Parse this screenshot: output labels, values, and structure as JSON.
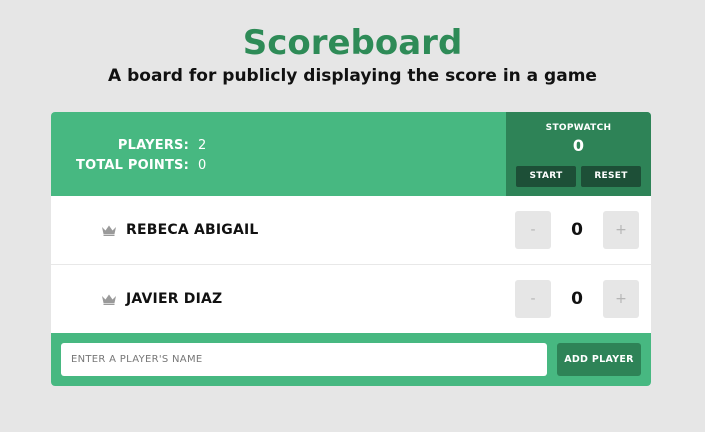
{
  "page": {
    "title": "Scoreboard",
    "subtitle": "A board for publicly displaying the score in a game"
  },
  "stats": {
    "players_label": "PLAYERS:",
    "players_value": "2",
    "points_label": "TOTAL POINTS:",
    "points_value": "0"
  },
  "stopwatch": {
    "label": "STOPWATCH",
    "time": "0",
    "start_label": "START",
    "reset_label": "RESET"
  },
  "players": [
    {
      "name": "REBECA ABIGAIL",
      "score": "0",
      "decrement_label": "-",
      "increment_label": "+",
      "icon": "crown-icon"
    },
    {
      "name": "JAVIER DIAZ",
      "score": "0",
      "decrement_label": "-",
      "increment_label": "+",
      "icon": "crown-icon"
    }
  ],
  "add_player": {
    "placeholder": "ENTER A PLAYER'S NAME",
    "value": "",
    "button_label": "ADD PLAYER"
  },
  "colors": {
    "accent": "#47b881",
    "accent_dark": "#2e8357",
    "title": "#2e8b57",
    "button_dark": "#1d4f37",
    "background": "#e6e6e6"
  }
}
